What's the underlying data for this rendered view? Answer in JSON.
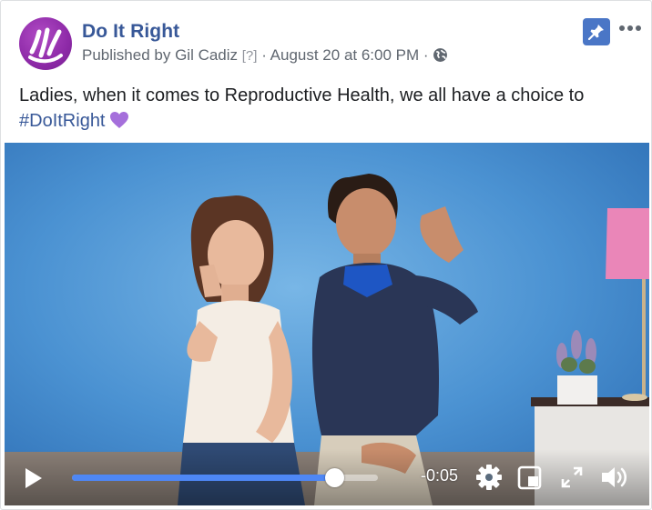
{
  "post": {
    "page_name": "Do It Right",
    "published_prefix": "Published by Gil Cadiz",
    "help_marker": "[?]",
    "separator": "·",
    "date": "August 20 at 6:00 PM",
    "audience_icon": "globe-icon",
    "text": "Ladies, when it comes to Reproductive Health, we all have a choice to",
    "hashtag": "#DoItRight",
    "emoji": "purple-heart"
  },
  "header_actions": {
    "pin_icon": "pin-icon",
    "more_icon": "more-icon"
  },
  "video": {
    "progress": 0.86,
    "time_remaining": "-0:05",
    "icons": [
      "play-icon",
      "settings-icon",
      "pip-icon",
      "fullscreen-icon",
      "volume-icon"
    ]
  },
  "colors": {
    "brand_link": "#385898",
    "pin_bg": "#4a76c6",
    "progress": "#4e87f5",
    "avatar": "#8e2aa8"
  }
}
